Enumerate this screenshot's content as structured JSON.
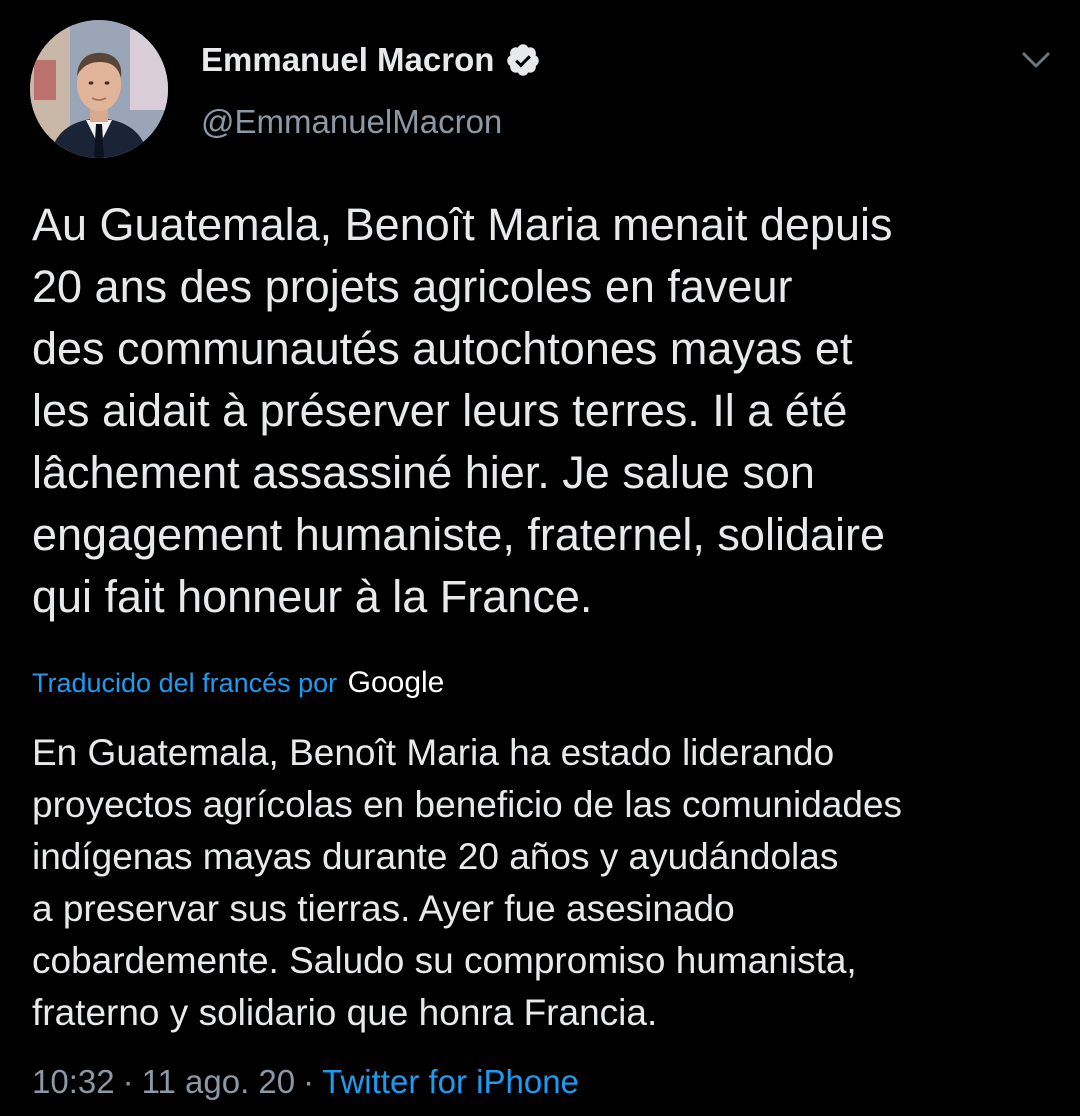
{
  "author": {
    "name": "Emmanuel Macron",
    "handle": "@EmmanuelMacron",
    "verified": true
  },
  "tweet": {
    "lines": [
      "Au Guatemala, Benoît Maria menait depuis",
      "20 ans des projets agricoles en faveur",
      "des communautés autochtones mayas et",
      "les aidait à préserver leurs terres. Il a été",
      "lâchement assassiné hier. Je salue son",
      "engagement humaniste, fraternel, solidaire",
      "qui fait honneur à la France."
    ]
  },
  "translation": {
    "label": "Traducido del francés por",
    "provider": "Google",
    "lines": [
      "En Guatemala, Benoît Maria ha estado liderando",
      "proyectos agrícolas en beneficio de las comunidades",
      "indígenas mayas durante 20 años y ayudándolas",
      "a preservar sus tierras. Ayer fue asesinado",
      "cobardemente. Saludo su compromiso humanista,",
      "fraterno y solidario que honra Francia."
    ]
  },
  "meta": {
    "time": "10:32",
    "separator": "·",
    "date": "11 ago. 20",
    "source": "Twitter for iPhone"
  },
  "colors": {
    "background": "#000000",
    "text": "#e7e9ea",
    "secondary": "#8b98a5",
    "accent": "#1d9bf0"
  },
  "icons": {
    "verified": "verified-badge-icon",
    "more": "chevron-down-icon"
  }
}
